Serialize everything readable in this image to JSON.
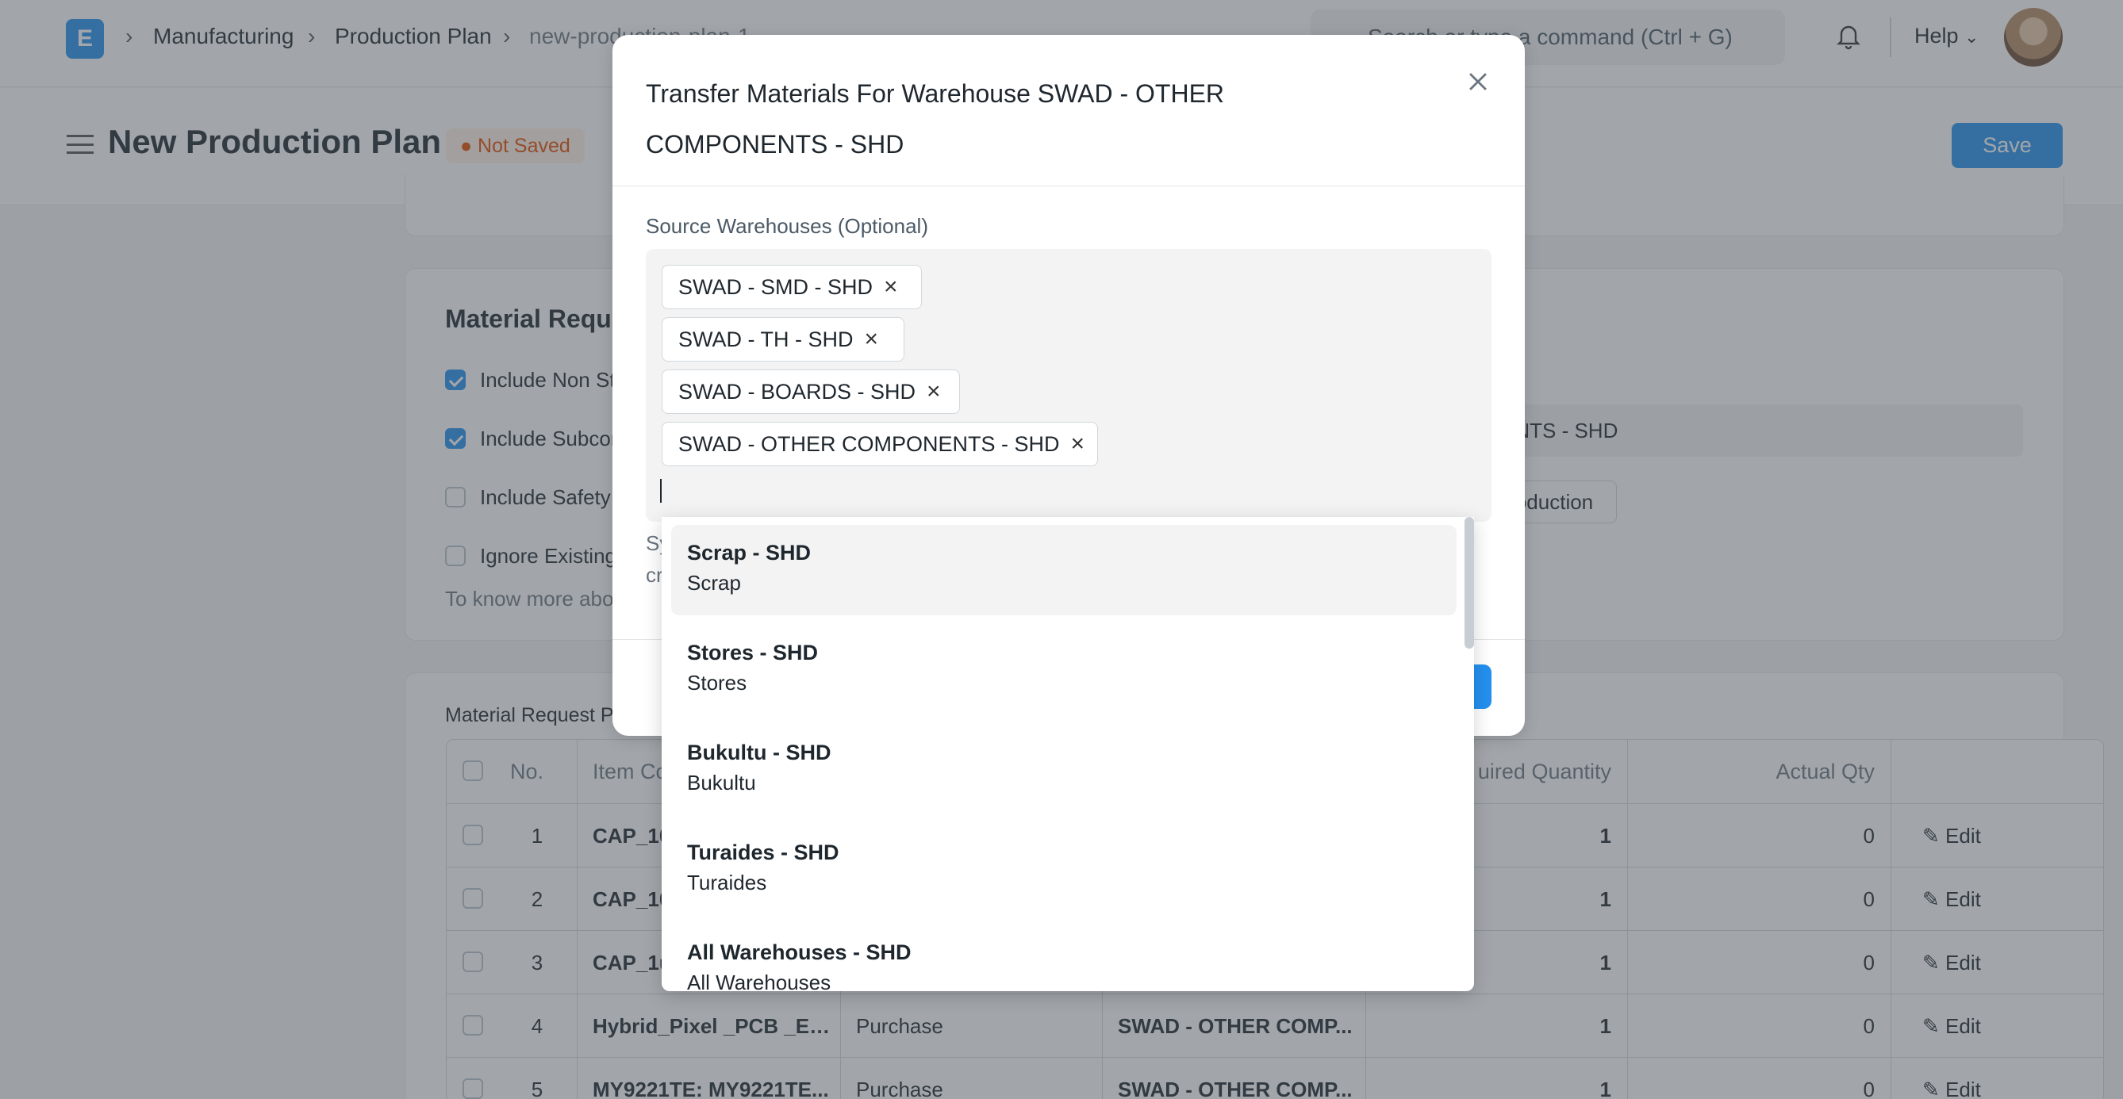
{
  "navbar": {
    "logo": "E",
    "breadcrumbs": [
      "Manufacturing",
      "Production Plan",
      "new-production-plan-1"
    ],
    "search_placeholder": "Search or type a command (Ctrl + G)",
    "help_label": "Help"
  },
  "page": {
    "title": "New Production Plan",
    "status": "Not Saved",
    "save_label": "Save"
  },
  "material_section": {
    "title": "Material Requ",
    "checkboxes": [
      {
        "label": "Include Non St",
        "checked": true
      },
      {
        "label": "Include Subcor",
        "checked": true
      },
      {
        "label": "Include Safety",
        "checked": false
      },
      {
        "label": "Ignore Existing",
        "checked": false
      }
    ],
    "help_text": "To know more abo",
    "warehouse_value": "ENTS - SHD",
    "button_label": "oduction"
  },
  "table": {
    "section_label": "Material Request P",
    "columns": [
      "No.",
      "Item Co",
      "",
      "",
      "uired Quantity",
      "Actual Qty",
      ""
    ],
    "rows": [
      {
        "no": "1",
        "item": "CAP_10",
        "type": "",
        "warehouse": "",
        "qty": "1",
        "actual": "0",
        "edit": "Edit"
      },
      {
        "no": "2",
        "item": "CAP_10",
        "type": "",
        "warehouse": "",
        "qty": "1",
        "actual": "0",
        "edit": "Edit"
      },
      {
        "no": "3",
        "item": "CAP_1u",
        "type": "",
        "warehouse": "",
        "qty": "1",
        "actual": "0",
        "edit": "Edit"
      },
      {
        "no": "4",
        "item": "Hybrid_Pixel _PCB _Em...",
        "type": "Purchase",
        "warehouse": "SWAD - OTHER COMP...",
        "qty": "1",
        "actual": "0",
        "edit": "Edit"
      },
      {
        "no": "5",
        "item": "MY9221TE: MY9221TE...",
        "type": "Purchase",
        "warehouse": "SWAD - OTHER COMP...",
        "qty": "1",
        "actual": "0",
        "edit": "Edit"
      }
    ]
  },
  "modal": {
    "title": "Transfer Materials For Warehouse SWAD - OTHER COMPONENTS - SHD",
    "field_label": "Source Warehouses (Optional)",
    "selected": [
      "SWAD - SMD - SHD",
      "SWAD - TH - SHD",
      "SWAD - BOARDS - SHD",
      "SWAD - OTHER COMPONENTS - SHD"
    ],
    "hint": "Sy",
    "hint2": "cr",
    "options": [
      {
        "title": "Scrap - SHD",
        "subtitle": "Scrap"
      },
      {
        "title": "Stores - SHD",
        "subtitle": "Stores"
      },
      {
        "title": "Bukultu - SHD",
        "subtitle": "Bukultu"
      },
      {
        "title": "Turaides - SHD",
        "subtitle": "Turaides"
      },
      {
        "title": "All Warehouses - SHD",
        "subtitle": "All Warehouses"
      }
    ]
  },
  "colors": {
    "primary": "#2490ef",
    "warning": "#e24c00"
  }
}
